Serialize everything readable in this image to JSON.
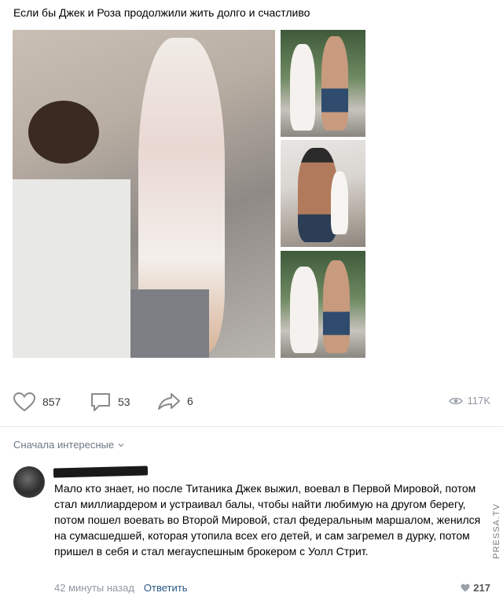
{
  "post": {
    "text": "Если бы Джек и Роза продолжили жить долго и счастливо"
  },
  "actions": {
    "likes": "857",
    "comments": "53",
    "shares": "6",
    "views": "117K"
  },
  "comments_section": {
    "sort_label": "Сначала интересные",
    "comment": {
      "text": "Мало кто знает, но после Титаника Джек выжил, воевал в Первой Мировой, потом стал миллиардером и устраивал балы, чтобы найти любимую на другом берегу, потом пошел воевать во Второй Мировой, стал федеральным маршалом, женился на сумасшедшей, которая утопила всех его детей, и сам загремел в дурку, потом пришел в себя и стал мегауспешным брокером с Уолл Стрит.",
      "time": "42 минуты назад",
      "reply_label": "Ответить",
      "likes": "217"
    }
  },
  "watermark": "PRESSA.TV"
}
